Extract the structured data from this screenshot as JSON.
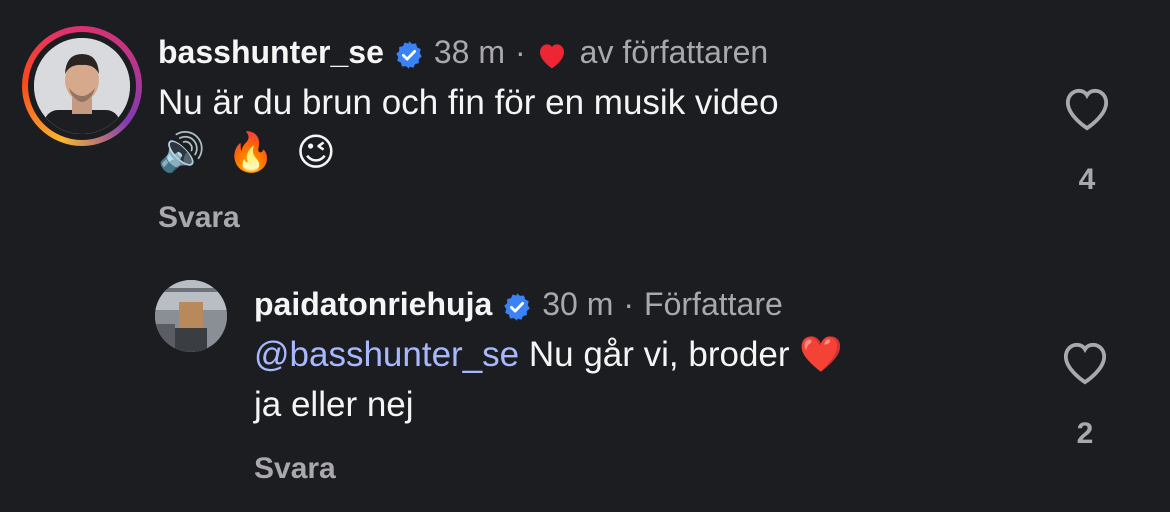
{
  "comments": [
    {
      "username": "basshunter_se",
      "time": "38 m",
      "liked_by_author_label": "av författaren",
      "text": "Nu är du brun och fin för en musik video",
      "emojis": [
        "🔊",
        "🔥",
        "😉"
      ],
      "reply_label": "Svara",
      "like_count": "4"
    },
    {
      "username": "paidatonriehuja",
      "time": "30 m",
      "author_label": "Författare",
      "mention": "@basshunter_se",
      "text": "Nu går vi, broder ❤️",
      "text_line2": "ja eller nej",
      "reply_label": "Svara",
      "like_count": "2"
    }
  ],
  "colors": {
    "background": "#1c1d21",
    "verified": "#3b82f6",
    "heart": "#ed2535",
    "mention": "#a8b8ff",
    "muted": "#a8a8ad"
  },
  "icons": {
    "verified": "verified-badge-icon",
    "like": "heart-outline-icon",
    "author_like": "heart-filled-icon"
  }
}
